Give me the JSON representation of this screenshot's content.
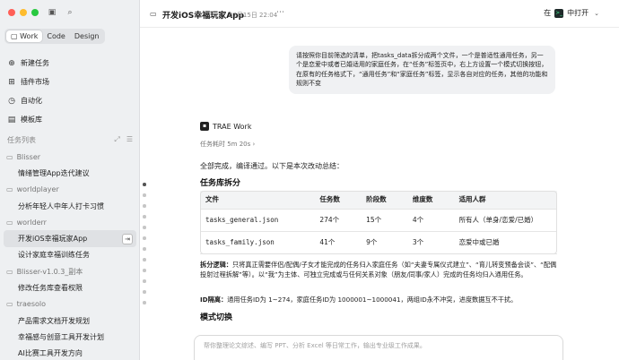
{
  "sidebar": {
    "mode_tabs": [
      "Work",
      "Code",
      "Design"
    ],
    "nav": [
      {
        "label": "新建任务",
        "icon": "new-task-icon",
        "glyph": "⊕"
      },
      {
        "label": "插件市场",
        "icon": "plugin-icon",
        "glyph": "⊞"
      },
      {
        "label": "自动化",
        "icon": "automation-icon",
        "glyph": "◷"
      },
      {
        "label": "模板库",
        "icon": "template-icon",
        "glyph": "▤"
      }
    ],
    "task_list_title": "任务列表",
    "groups": [
      {
        "name": "Blisser",
        "tasks": [
          "情绪管理App迭代建议"
        ]
      },
      {
        "name": "worldplayer",
        "tasks": [
          "分析年轻人中年人打卡习惯"
        ]
      },
      {
        "name": "worlderr",
        "tasks": [
          "开发iOS幸福玩家App",
          "设计家庭幸福训练任务"
        ]
      },
      {
        "name": "Blisser-v1.0.3_副本",
        "tasks": [
          "修改任务库查看权限"
        ]
      },
      {
        "name": "traesolo",
        "tasks": [
          "产品需求文档开发规划",
          "幸福感与创意工具开发计划",
          "AI比赛工具开发方向"
        ]
      }
    ],
    "active_task": "开发iOS幸福玩家App"
  },
  "header": {
    "title": "开发iOS幸福玩家App",
    "date": "07月15日 22:04",
    "open_in_prefix": "在",
    "open_in_label": "中打开"
  },
  "user_message": "请按照你目前筛选的清单，把tasks_data拆分成两个文件，一个是普适性通用任务，另一个是恋爱中或者已婚适用的家庭任务，在“任务”标签页中，右上方设置一个模式切换按钮，在原有的任务格式下，“通用任务”和“家庭任务”标签，显示各自对应的任务，其他的功能和规则不变",
  "agent": {
    "name": "TRAE Work",
    "elapsed": "任务耗时 5m 20s",
    "summary": "全部完成，编译通过。以下是本次改动总结：",
    "section_split": "任务库拆分",
    "table": {
      "headers": [
        "文件",
        "任务数",
        "阶段数",
        "维度数",
        "适用人群"
      ],
      "rows": [
        [
          "tasks_general.json",
          "274个",
          "15个",
          "4个",
          "所有人（单身/恋爱/已婚）"
        ],
        [
          "tasks_family.json",
          "41个",
          "9个",
          "3个",
          "恋爱中或已婚"
        ]
      ]
    },
    "logic_label": "拆分逻辑：",
    "logic_text": "只将真正需要伴侣/配偶/子女才能完成的任务归入家庭任务（如“夫妻专属仪式建立”、“育儿转变预备会谈”、“配偶投射过程拆解”等）。以“我”为主体、可独立完成或与任何关系对象（朋友/同事/家人）完成的任务均归入通用任务。",
    "id_label": "ID隔离：",
    "id_text": "通用任务ID为 1~274，家庭任务ID为 1000001~1000041，两组ID永不冲突，进度数据互不干扰。",
    "section_mode": "模式切换"
  },
  "composer": {
    "placeholder": "帮你整理论文综述、编写 PPT、分析 Excel 等日常工作，输出专业级工作成果。"
  }
}
